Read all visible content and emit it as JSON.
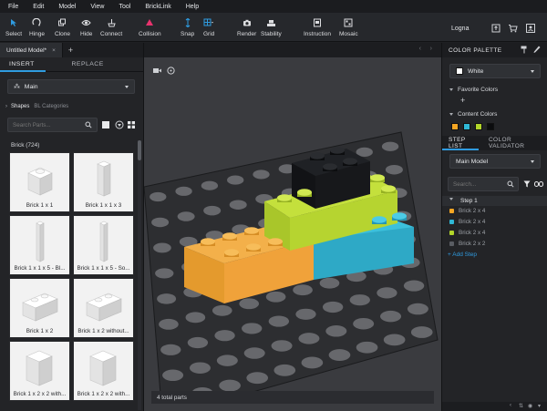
{
  "menu": [
    "File",
    "Edit",
    "Model",
    "View",
    "Tool",
    "BrickLink",
    "Help"
  ],
  "toolbar": {
    "select": "Select",
    "hinge": "Hinge",
    "clone": "Clone",
    "hide": "Hide",
    "connect": "Connect",
    "collision": "Collision",
    "snap": "Snap",
    "grid": "Grid",
    "render": "Render",
    "stability": "Stability",
    "instruction": "Instruction",
    "mosaic": "Mosaic",
    "user": "Logna"
  },
  "doc_tab": {
    "title": "Untitled Model*",
    "close": "×",
    "add": "+"
  },
  "left": {
    "tabs": [
      "INSERT",
      "REPLACE"
    ],
    "library": "Main",
    "subtabs": [
      "Shapes",
      "BL Categories"
    ],
    "search_placeholder": "Search Parts...",
    "category_count": "Brick (724)",
    "parts": [
      "Brick 1 x 1",
      "Brick 1 x 1 x 3",
      "Brick 1 x 1 x 5 - Bl...",
      "Brick 1 x 1 x 5 - So...",
      "Brick 1 x 2",
      "Brick 1 x 2 without...",
      "Brick 1 x 2 x 2 with...",
      "Brick 1 x 2 x 2 with..."
    ]
  },
  "viewport": {
    "total_parts": "4 total parts"
  },
  "right": {
    "palette_title": "COLOR PALETTE",
    "current_color": "White",
    "favorite_colors": "Favorite Colors",
    "add_symbol": "+",
    "content_colors": "Content Colors",
    "content_color_swatches": [
      "#f5a623",
      "#2fb8d6",
      "#b3d62a",
      "#0b0c0e"
    ],
    "step_tabs": [
      "STEP LIST",
      "COLOR VALIDATOR"
    ],
    "model": "Main Model",
    "search_placeholder": "Search...",
    "step_title": "Step 1",
    "step_items": [
      {
        "label": "Brick 2 x 4",
        "color": "#f5a623"
      },
      {
        "label": "Brick 2 x 4",
        "color": "#2fb8d6"
      },
      {
        "label": "Brick 2 x 4",
        "color": "#b3d62a"
      },
      {
        "label": "Brick 2 x 2",
        "color": "#5a5d63"
      }
    ],
    "add_step": "Add Step"
  },
  "colors": {
    "accent_blue": "#2f9be0",
    "collision_pink": "#e8336e",
    "panel": "#232427"
  }
}
